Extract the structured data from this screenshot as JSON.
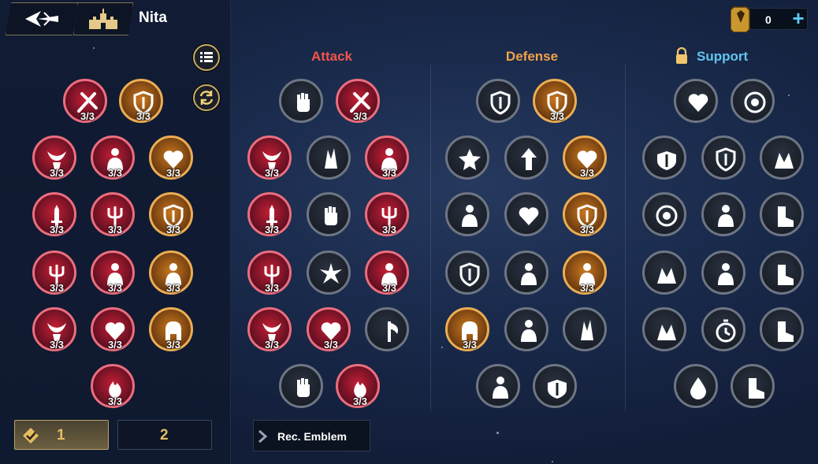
{
  "header": {
    "hero_name": "Nita"
  },
  "currency": {
    "value": "0"
  },
  "categories": {
    "attack": "Attack",
    "defense": "Defense",
    "support": "Support"
  },
  "colors": {
    "attack": "#f2554b",
    "defense": "#f0a14a",
    "support": "#62c4ee",
    "gold": "#e4bd63"
  },
  "count_label": "3/3",
  "rec_emblem": "Rec. Emblem",
  "tabs": [
    "1",
    "2"
  ],
  "selected_tab": 0,
  "preview": [
    {
      "row": 0,
      "icons": [
        {
          "style": "red",
          "count": true,
          "icon": "crossed-swords-icon"
        },
        {
          "style": "gold",
          "count": true,
          "icon": "shield-icon"
        }
      ]
    },
    {
      "row": 1,
      "icons": [
        {
          "style": "red",
          "count": true,
          "icon": "demon-horns-icon"
        },
        {
          "style": "red",
          "count": true,
          "icon": "power-up-figure-icon"
        },
        {
          "style": "gold",
          "count": true,
          "icon": "heart-plus-icon"
        }
      ]
    },
    {
      "row": 2,
      "icons": [
        {
          "style": "red",
          "count": true,
          "icon": "single-sword-icon"
        },
        {
          "style": "red",
          "count": true,
          "icon": "triple-sword-icon"
        },
        {
          "style": "gold",
          "count": true,
          "icon": "crest-shield-icon"
        }
      ]
    },
    {
      "row": 3,
      "icons": [
        {
          "style": "red",
          "count": true,
          "icon": "winged-trident-icon"
        },
        {
          "style": "red",
          "count": true,
          "icon": "arrow-hit-figure-icon"
        },
        {
          "style": "gold",
          "count": true,
          "icon": "crowned-figure-icon"
        }
      ]
    },
    {
      "row": 4,
      "icons": [
        {
          "style": "red",
          "count": true,
          "icon": "horned-skull-icon"
        },
        {
          "style": "red",
          "count": true,
          "icon": "broken-heart-icon"
        },
        {
          "style": "gold",
          "count": true,
          "icon": "helmet-icon"
        }
      ]
    },
    {
      "row": 5,
      "icons": [
        {
          "style": "red",
          "count": true,
          "icon": "flame-icon"
        }
      ]
    }
  ],
  "attack_tree": [
    {
      "row": 0,
      "icons": [
        {
          "style": "grey",
          "count": false,
          "icon": "fist-icon"
        },
        {
          "style": "red",
          "count": true,
          "icon": "crossed-swords-icon"
        }
      ]
    },
    {
      "row": 1,
      "icons": [
        {
          "style": "red",
          "count": true,
          "icon": "demon-horns-icon"
        },
        {
          "style": "grey",
          "count": false,
          "icon": "shattered-glass-icon"
        },
        {
          "style": "red",
          "count": true,
          "icon": "power-up-figure-icon"
        }
      ]
    },
    {
      "row": 2,
      "icons": [
        {
          "style": "red",
          "count": true,
          "icon": "single-sword-icon"
        },
        {
          "style": "grey",
          "count": false,
          "icon": "bound-fist-icon"
        },
        {
          "style": "red",
          "count": true,
          "icon": "triple-sword-icon"
        }
      ]
    },
    {
      "row": 3,
      "icons": [
        {
          "style": "red",
          "count": true,
          "icon": "winged-trident-icon"
        },
        {
          "style": "grey",
          "count": false,
          "icon": "spike-burst-icon"
        },
        {
          "style": "red",
          "count": true,
          "icon": "arrow-hit-figure-icon"
        }
      ]
    },
    {
      "row": 4,
      "icons": [
        {
          "style": "red",
          "count": true,
          "icon": "horned-skull-icon"
        },
        {
          "style": "red",
          "count": true,
          "icon": "broken-heart-icon"
        },
        {
          "style": "grey",
          "count": false,
          "icon": "axe-icon"
        }
      ]
    },
    {
      "row": 5,
      "icons": [
        {
          "style": "grey",
          "count": false,
          "icon": "gauntlet-sparkle-icon"
        },
        {
          "style": "red",
          "count": true,
          "icon": "flame-icon"
        }
      ]
    }
  ],
  "defense_tree": [
    {
      "row": 0,
      "icons": [
        {
          "style": "grey",
          "count": false,
          "icon": "shield-icon"
        },
        {
          "style": "gold",
          "count": true,
          "icon": "shield-icon"
        }
      ]
    },
    {
      "row": 1,
      "icons": [
        {
          "style": "grey",
          "count": false,
          "icon": "star-shield-icon"
        },
        {
          "style": "grey",
          "count": false,
          "icon": "arrow-up-icon"
        },
        {
          "style": "gold",
          "count": true,
          "icon": "heart-plus-icon"
        }
      ]
    },
    {
      "row": 2,
      "icons": [
        {
          "style": "grey",
          "count": false,
          "icon": "parry-figure-icon"
        },
        {
          "style": "grey",
          "count": false,
          "icon": "cracked-heart-icon"
        },
        {
          "style": "gold",
          "count": true,
          "icon": "crest-shield-icon"
        }
      ]
    },
    {
      "row": 3,
      "icons": [
        {
          "style": "grey",
          "count": false,
          "icon": "arrow-shield-icon"
        },
        {
          "style": "grey",
          "count": false,
          "icon": "guard-figure-icon"
        },
        {
          "style": "gold",
          "count": true,
          "icon": "crowned-figure-icon"
        }
      ]
    },
    {
      "row": 4,
      "icons": [
        {
          "style": "gold",
          "count": true,
          "icon": "helmet-icon"
        },
        {
          "style": "grey",
          "count": false,
          "icon": "sparkle-figure-icon"
        },
        {
          "style": "grey",
          "count": false,
          "icon": "chain-block-icon"
        }
      ]
    },
    {
      "row": 5,
      "icons": [
        {
          "style": "grey",
          "count": false,
          "icon": "meditating-figure-icon"
        },
        {
          "style": "grey",
          "count": false,
          "icon": "winged-shield-icon"
        }
      ]
    }
  ],
  "support_tree": [
    {
      "row": 0,
      "icons": [
        {
          "style": "grey",
          "count": false,
          "icon": "heart-outline-icon"
        },
        {
          "style": "grey",
          "count": false,
          "icon": "crosshair-icon"
        }
      ]
    },
    {
      "row": 1,
      "icons": [
        {
          "style": "grey",
          "count": false,
          "icon": "winged-shield-icon"
        },
        {
          "style": "grey",
          "count": false,
          "icon": "chain-shield-icon"
        },
        {
          "style": "grey",
          "count": false,
          "icon": "hands-heart-icon"
        }
      ]
    },
    {
      "row": 2,
      "icons": [
        {
          "style": "grey",
          "count": false,
          "icon": "target-icon"
        },
        {
          "style": "grey",
          "count": false,
          "icon": "sparkle-figure-icon"
        },
        {
          "style": "grey",
          "count": false,
          "icon": "boot-wing-icon"
        }
      ]
    },
    {
      "row": 3,
      "icons": [
        {
          "style": "grey",
          "count": false,
          "icon": "praying-hands-icon"
        },
        {
          "style": "grey",
          "count": false,
          "icon": "crowned-figure-icon"
        },
        {
          "style": "grey",
          "count": false,
          "icon": "horn-icon"
        }
      ]
    },
    {
      "row": 4,
      "icons": [
        {
          "style": "grey",
          "count": false,
          "icon": "hand-sparkle-icon"
        },
        {
          "style": "grey",
          "count": false,
          "icon": "stopwatch-icon"
        },
        {
          "style": "grey",
          "count": false,
          "icon": "boot-gear-icon"
        }
      ]
    },
    {
      "row": 5,
      "icons": [
        {
          "style": "grey",
          "count": false,
          "icon": "water-drop-icon"
        },
        {
          "style": "grey",
          "count": false,
          "icon": "dash-boot-icon"
        }
      ]
    }
  ]
}
